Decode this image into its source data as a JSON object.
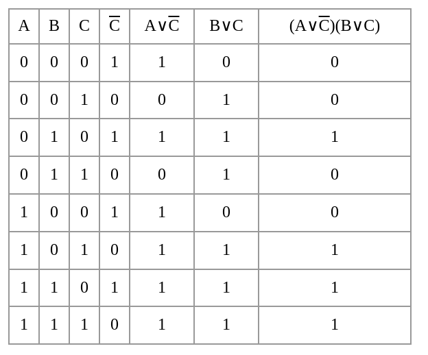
{
  "chart_data": {
    "type": "table",
    "title": "",
    "headers": {
      "A": "A",
      "B": "B",
      "C": "C",
      "notC_letter": "C",
      "AorNotC_A": "A",
      "AorNotC_or": "∨",
      "AorNotC_C": "C",
      "BorC_B": "B",
      "BorC_or": "∨",
      "BorC_C": "C",
      "last_open1": "(",
      "last_A": "A",
      "last_or1": "∨",
      "last_C1": "C",
      "last_close1": ")",
      "last_open2": "(",
      "last_B": "B",
      "last_or2": "∨",
      "last_C2": "C",
      "last_close2": ")"
    },
    "rows": [
      {
        "A": "0",
        "B": "0",
        "C": "0",
        "notC": "1",
        "AorNotC": "1",
        "BorC": "0",
        "product": "0"
      },
      {
        "A": "0",
        "B": "0",
        "C": "1",
        "notC": "0",
        "AorNotC": "0",
        "BorC": "1",
        "product": "0"
      },
      {
        "A": "0",
        "B": "1",
        "C": "0",
        "notC": "1",
        "AorNotC": "1",
        "BorC": "1",
        "product": "1"
      },
      {
        "A": "0",
        "B": "1",
        "C": "1",
        "notC": "0",
        "AorNotC": "0",
        "BorC": "1",
        "product": "0"
      },
      {
        "A": "1",
        "B": "0",
        "C": "0",
        "notC": "1",
        "AorNotC": "1",
        "BorC": "0",
        "product": "0"
      },
      {
        "A": "1",
        "B": "0",
        "C": "1",
        "notC": "0",
        "AorNotC": "1",
        "BorC": "1",
        "product": "1"
      },
      {
        "A": "1",
        "B": "1",
        "C": "0",
        "notC": "1",
        "AorNotC": "1",
        "BorC": "1",
        "product": "1"
      },
      {
        "A": "1",
        "B": "1",
        "C": "1",
        "notC": "0",
        "AorNotC": "1",
        "BorC": "1",
        "product": "1"
      }
    ]
  }
}
